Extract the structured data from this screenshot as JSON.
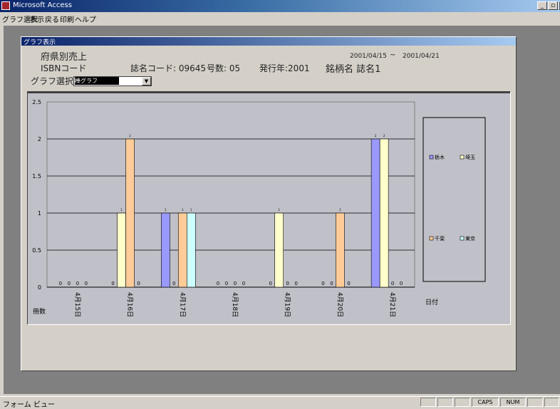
{
  "window": {
    "title": "Microsoft Access",
    "buttons": [
      "_",
      "▫",
      "x"
    ]
  },
  "menubar": {
    "items": [
      "グラフ選択",
      "表示",
      "戻る",
      "印刷",
      "ヘルプ"
    ]
  },
  "form": {
    "title": "グラフ表示",
    "region": "府県別売上",
    "date_from": "2001/04/15",
    "date_sep": "~",
    "date_to": "2001/04/21",
    "isbn_label": "ISBNコード",
    "magazine_code": "誌名コード: 09645",
    "issue_no": "号数: 05",
    "year": "発行年:2001",
    "brand": "銘柄名 誌名1",
    "graph_select_label": "グラフ選択",
    "graph_select_value": "棒グラフ"
  },
  "chart_data": {
    "type": "bar",
    "categories": [
      "4月15日",
      "4月16日",
      "4月17日",
      "4月18日",
      "4月19日",
      "4月20日",
      "4月21日"
    ],
    "series": [
      {
        "name": "栃木",
        "color": "#9999ff",
        "values": [
          0,
          0,
          1,
          0,
          0,
          0,
          2
        ]
      },
      {
        "name": "埼玉",
        "color": "#ffffcc",
        "values": [
          0,
          1,
          0,
          0,
          1,
          0,
          2
        ]
      },
      {
        "name": "千葉",
        "color": "#ffcc99",
        "values": [
          0,
          2,
          1,
          0,
          0,
          1,
          0
        ]
      },
      {
        "name": "東京",
        "color": "#ccffff",
        "values": [
          0,
          0,
          1,
          0,
          0,
          0,
          0
        ]
      }
    ],
    "y_ticks": [
      "0",
      "0.5",
      "1",
      "1.5",
      "2",
      "2.5"
    ],
    "ylim": [
      0,
      2.5
    ],
    "xlabel": "日付",
    "ylabel": "冊数",
    "value_labels": {
      "1": "1",
      "2": "2",
      "0": "0"
    },
    "grid": true,
    "legend_position": "right"
  },
  "statusbar": {
    "text": "フォーム ビュー",
    "panels": [
      "",
      "",
      "",
      "CAPS",
      "NUM",
      "",
      ""
    ]
  }
}
